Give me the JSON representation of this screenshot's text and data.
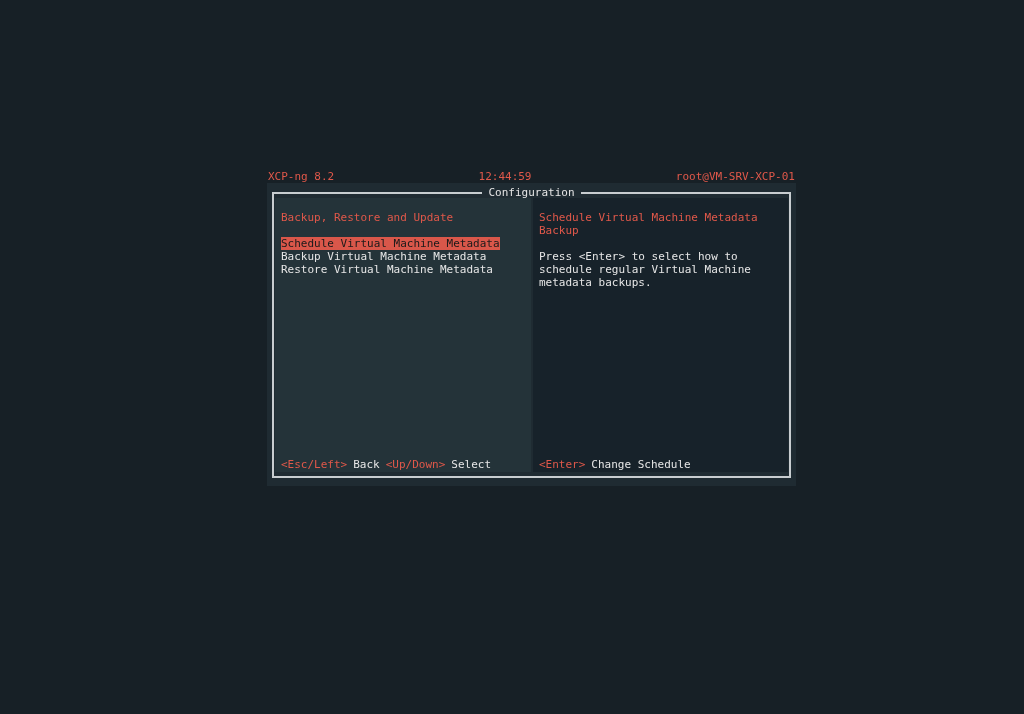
{
  "header": {
    "product": "XCP-ng 8.2",
    "time": "12:44:59",
    "host": "root@VM-SRV-XCP-01"
  },
  "dialog": {
    "title": "Configuration"
  },
  "left_pane": {
    "heading": "Backup, Restore and Update",
    "menu": [
      {
        "label": "Schedule Virtual Machine Metadata",
        "selected": true
      },
      {
        "label": "Backup Virtual Machine Metadata",
        "selected": false
      },
      {
        "label": "Restore Virtual Machine Metadata",
        "selected": false
      }
    ],
    "hints": [
      {
        "key": "<Esc/Left>",
        "label": "Back"
      },
      {
        "key": "<Up/Down>",
        "label": "Select"
      }
    ]
  },
  "right_pane": {
    "heading": "Schedule Virtual Machine Metadata Backup",
    "description": "Press <Enter> to select how to schedule regular Virtual Machine metadata backups.",
    "hints": [
      {
        "key": "<Enter>",
        "label": "Change Schedule"
      }
    ]
  }
}
